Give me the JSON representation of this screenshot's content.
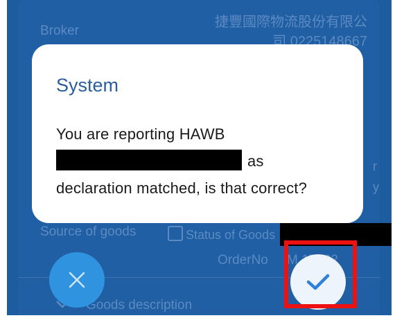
{
  "background": {
    "broker_label": "Broker",
    "broker_value_line1": "捷豐國際物流股份有限公",
    "broker_value_line2": "司 0225148667",
    "side_text_line1": "r",
    "side_text_line2": "y",
    "source_label": "Source of goods",
    "status_of_goods_label": "Status of Goods",
    "order_no_label": "OrderNo",
    "order_no_value": "M     17122",
    "goods_description": "Goods description"
  },
  "dialog": {
    "title": "System",
    "message_part1": "You are reporting HAWB",
    "message_part2": "as",
    "message_part3": "declaration matched, is that correct?"
  },
  "buttons": {
    "cancel_icon": "close-icon",
    "confirm_icon": "checkmark-icon"
  },
  "colors": {
    "overlay": "#1d5d9f",
    "cancel": "#2f93e0",
    "confirm_bg": "#eef4fb",
    "checkmark": "#2f80d8",
    "highlight": "#ee1111",
    "title": "#2a5d9c"
  }
}
